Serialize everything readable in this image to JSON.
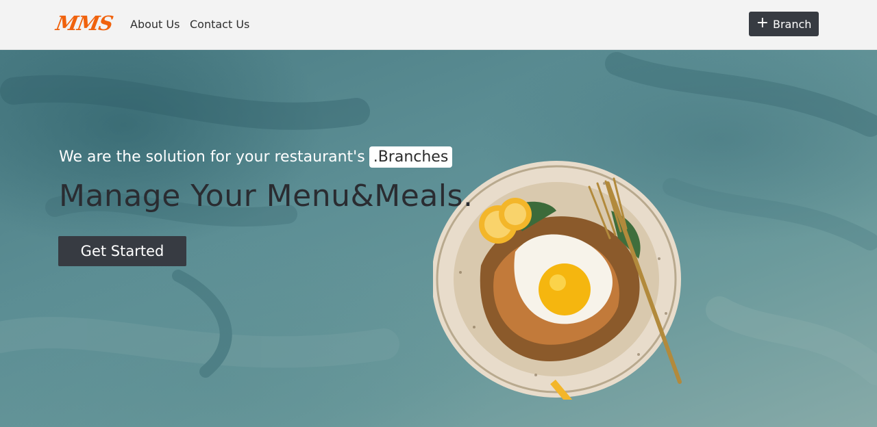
{
  "nav": {
    "logo": "MMS",
    "links": [
      "About Us",
      "Contact Us"
    ],
    "add_branch": {
      "icon": "plus-icon",
      "label": "Branch"
    }
  },
  "hero": {
    "tagline": "We are the solution for your restaurant's",
    "tagline_highlight": ".Branches",
    "headline": "Manage Your Menu&Meals.",
    "cta_label": "Get Started",
    "image": "food-plate-image"
  },
  "colors": {
    "logo": "#f0620d",
    "navbar_bg": "#f3f3f3",
    "button_bg": "#373b42",
    "headline": "#2a2c31"
  }
}
